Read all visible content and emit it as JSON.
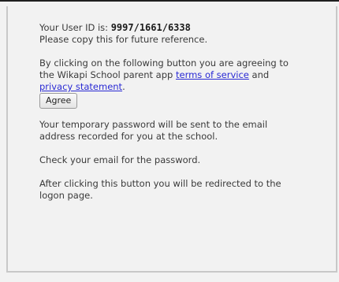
{
  "registration": {
    "user_id_prefix": "Your User ID is: ",
    "user_id": "9997/1661/6338",
    "copy_note": "Please copy this for future reference.",
    "agreement_text": "By clicking on the following button you are agreeing to the Wikapi School parent app ",
    "terms_link": "terms of service",
    "and_text": " and ",
    "privacy_link": "privacy statement",
    "period": ".",
    "agree_button": "Agree",
    "password_notice": "Your temporary password will be sent to the email address recorded for you at the school.",
    "check_email": "Check your email for the password.",
    "redirect_notice": "After clicking this button you will be redirected to the logon page."
  }
}
